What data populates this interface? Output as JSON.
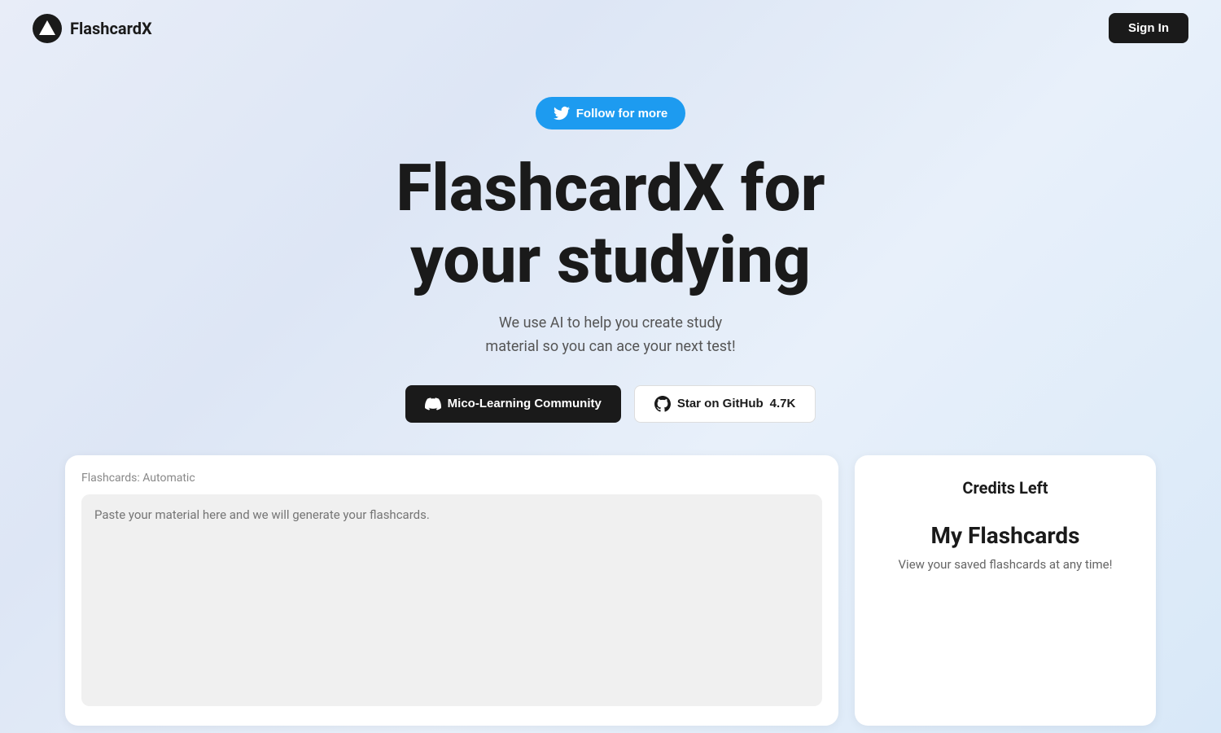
{
  "navbar": {
    "logo_text": "FlashcardX",
    "sign_in_label": "Sign In"
  },
  "hero": {
    "follow_btn_label": "Follow for more",
    "title_line1": "FlashcardX for",
    "title_line2": "your studying",
    "subtitle_line1": "We use AI to help you create study",
    "subtitle_line2": "material so you can ace your next test!",
    "community_btn_label": "Mico-Learning Community",
    "github_btn_label": "Star on GitHub",
    "github_star_count": "4.7K"
  },
  "flashcard_panel": {
    "label": "Flashcards: Automatic",
    "placeholder": "Paste your material here and we will generate your flashcards."
  },
  "credits_panel": {
    "title": "Credits Left",
    "my_flashcards_title": "My Flashcards",
    "my_flashcards_subtitle": "View your saved flashcards at any time!"
  }
}
